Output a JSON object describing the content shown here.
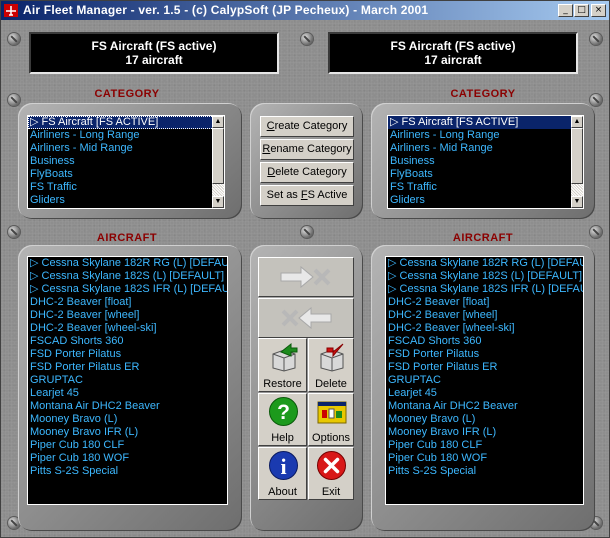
{
  "window": {
    "title": "Air Fleet Manager - ver. 1.5 - (c) CalypSoft (JP Pecheux) -  March  2001",
    "min_glyph": "_",
    "max_glyph": "□",
    "close_glyph": "×"
  },
  "left": {
    "display_line1": "FS Aircraft (FS active)",
    "display_line2": "17 aircraft",
    "category_label": "CATEGORY",
    "aircraft_label": "AIRCRAFT",
    "categories": [
      "▷ FS Aircraft [FS ACTIVE]",
      "Airliners - Long Range",
      "Airliners - Mid Range",
      "Business",
      "FlyBoats",
      "FS Traffic",
      "Gliders"
    ],
    "aircraft": [
      "▷ Cessna Skylane 182R RG (L) [DEFAUL",
      "▷ Cessna Skylane 182S (L) [DEFAULT]",
      "▷ Cessna Skylane 182S IFR (L) [DEFAUL",
      "DHC-2 Beaver [float]",
      "DHC-2 Beaver [wheel]",
      "DHC-2 Beaver [wheel-ski]",
      "FSCAD Shorts 360",
      "FSD  Porter Pilatus",
      "FSD Porter Pilatus ER",
      "GRUPTAC",
      "Learjet 45",
      "Montana Air DHC2 Beaver",
      "Mooney Bravo (L)",
      "Mooney Bravo IFR (L)",
      "Piper Cub 180 CLF",
      "Piper Cub 180 WOF",
      "Pitts S-2S Special"
    ]
  },
  "right": {
    "display_line1": "FS Aircraft (FS active)",
    "display_line2": "17 aircraft",
    "category_label": "CATEGORY",
    "aircraft_label": "AIRCRAFT",
    "categories": [
      "▷ FS Aircraft [FS ACTIVE]",
      "Airliners - Long Range",
      "Airliners - Mid Range",
      "Business",
      "FlyBoats",
      "FS Traffic",
      "Gliders"
    ],
    "aircraft": [
      "▷ Cessna Skylane 182R RG (L) [DEFAUL",
      "▷ Cessna Skylane 182S (L) [DEFAULT]",
      "▷ Cessna Skylane 182S IFR (L) [DEFAUL",
      "DHC-2 Beaver [float]",
      "DHC-2 Beaver [wheel]",
      "DHC-2 Beaver [wheel-ski]",
      "FSCAD Shorts 360",
      "FSD  Porter Pilatus",
      "FSD Porter Pilatus ER",
      "GRUPTAC",
      "Learjet 45",
      "Montana Air DHC2 Beaver",
      "Mooney Bravo (L)",
      "Mooney Bravo IFR (L)",
      "Piper Cub 180 CLF",
      "Piper Cub 180 WOF",
      "Pitts S-2S Special"
    ]
  },
  "category_buttons": {
    "create": {
      "pre": "",
      "key": "C",
      "post": "reate Category"
    },
    "rename": {
      "pre": "",
      "key": "R",
      "post": "ename Category"
    },
    "delete": {
      "pre": "",
      "key": "D",
      "post": "elete Category"
    },
    "set_active": {
      "pre": "Set as ",
      "key": "F",
      "post": "S Active"
    }
  },
  "tools": {
    "restore": "Restore",
    "delete": "Delete",
    "help": "Help",
    "options": "Options",
    "about": "About",
    "exit": "Exit"
  },
  "colors": {
    "title_gradient_start": "#0a246a",
    "list_text": "#3db8ff",
    "section_label": "#8b0000",
    "selection": "#0a246a"
  },
  "icons": {
    "restore": "box-arrow-up-icon",
    "delete": "box-arrow-down-icon",
    "help": "question-icon",
    "options": "options-dialog-icon",
    "about": "info-icon",
    "exit": "close-x-icon",
    "copy_right": "arrow-right-airplane-icon",
    "copy_left": "arrow-left-airplane-icon"
  }
}
